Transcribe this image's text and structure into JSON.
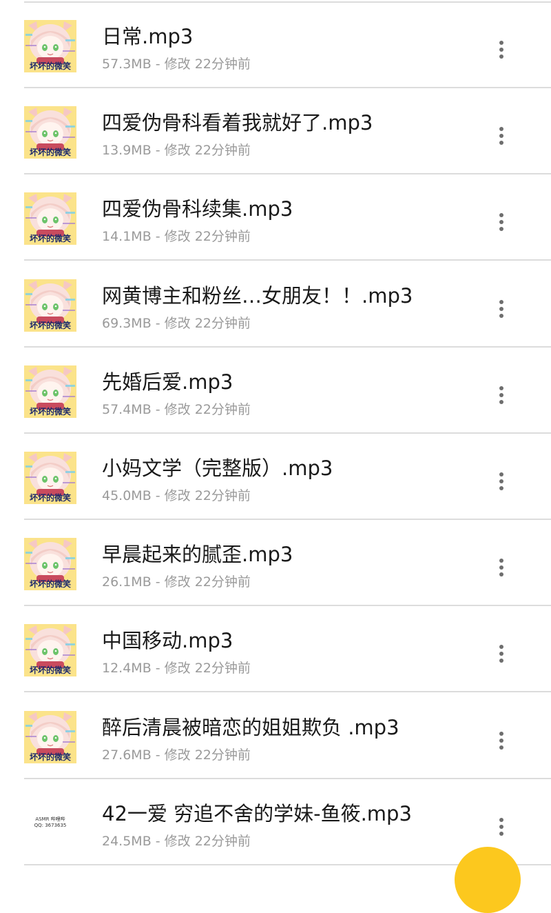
{
  "files": [
    {
      "name": "日常.mp3",
      "size": "57.3MB",
      "separator": " - ",
      "modified": "修改 22分钟前",
      "thumb": "anime-cover",
      "thumb_caption": "坏坏的微笑"
    },
    {
      "name": "四爱伪骨科看着我就好了.mp3",
      "size": "13.9MB",
      "separator": " - ",
      "modified": "修改 22分钟前",
      "thumb": "anime-cover",
      "thumb_caption": "坏坏的微笑"
    },
    {
      "name": "四爱伪骨科续集.mp3",
      "size": "14.1MB",
      "separator": " - ",
      "modified": "修改 22分钟前",
      "thumb": "anime-cover",
      "thumb_caption": "坏坏的微笑"
    },
    {
      "name": "网黄博主和粉丝…女朋友！！.mp3",
      "size": "69.3MB",
      "separator": " - ",
      "modified": "修改 22分钟前",
      "thumb": "anime-cover",
      "thumb_caption": "坏坏的微笑"
    },
    {
      "name": "先婚后爱.mp3",
      "size": "57.4MB",
      "separator": " - ",
      "modified": "修改 22分钟前",
      "thumb": "anime-cover",
      "thumb_caption": "坏坏的微笑"
    },
    {
      "name": "小妈文学（完整版）.mp3",
      "size": "45.0MB",
      "separator": " - ",
      "modified": "修改 22分钟前",
      "thumb": "anime-cover",
      "thumb_caption": "坏坏的微笑"
    },
    {
      "name": "早晨起来的腻歪.mp3",
      "size": "26.1MB",
      "separator": " - ",
      "modified": "修改 22分钟前",
      "thumb": "anime-cover",
      "thumb_caption": "坏坏的微笑"
    },
    {
      "name": "中国移动.mp3",
      "size": "12.4MB",
      "separator": " - ",
      "modified": "修改 22分钟前",
      "thumb": "anime-cover",
      "thumb_caption": "坏坏的微笑"
    },
    {
      "name": "醉后清晨被暗恋的姐姐欺负 .mp3",
      "size": "27.6MB",
      "separator": " - ",
      "modified": "修改 22分钟前",
      "thumb": "anime-cover",
      "thumb_caption": "坏坏的微笑"
    },
    {
      "name": "42一爱 穷追不舍的学妹-鱼筱.mp3",
      "size": "24.5MB",
      "separator": " - ",
      "modified": "修改 22分钟前",
      "thumb": "text-cover",
      "thumb_lines": [
        "ASMR 哔哩哔",
        "QQ: 3673635"
      ]
    }
  ],
  "icons": {
    "more": "more-vertical-icon",
    "fab": "floating-action-button"
  },
  "colors": {
    "title": "#1a1a1a",
    "meta": "#9a9a9a",
    "divider": "#dcdcdc",
    "fab": "#fcc81e",
    "thumb_bg": "#fbe38a"
  }
}
